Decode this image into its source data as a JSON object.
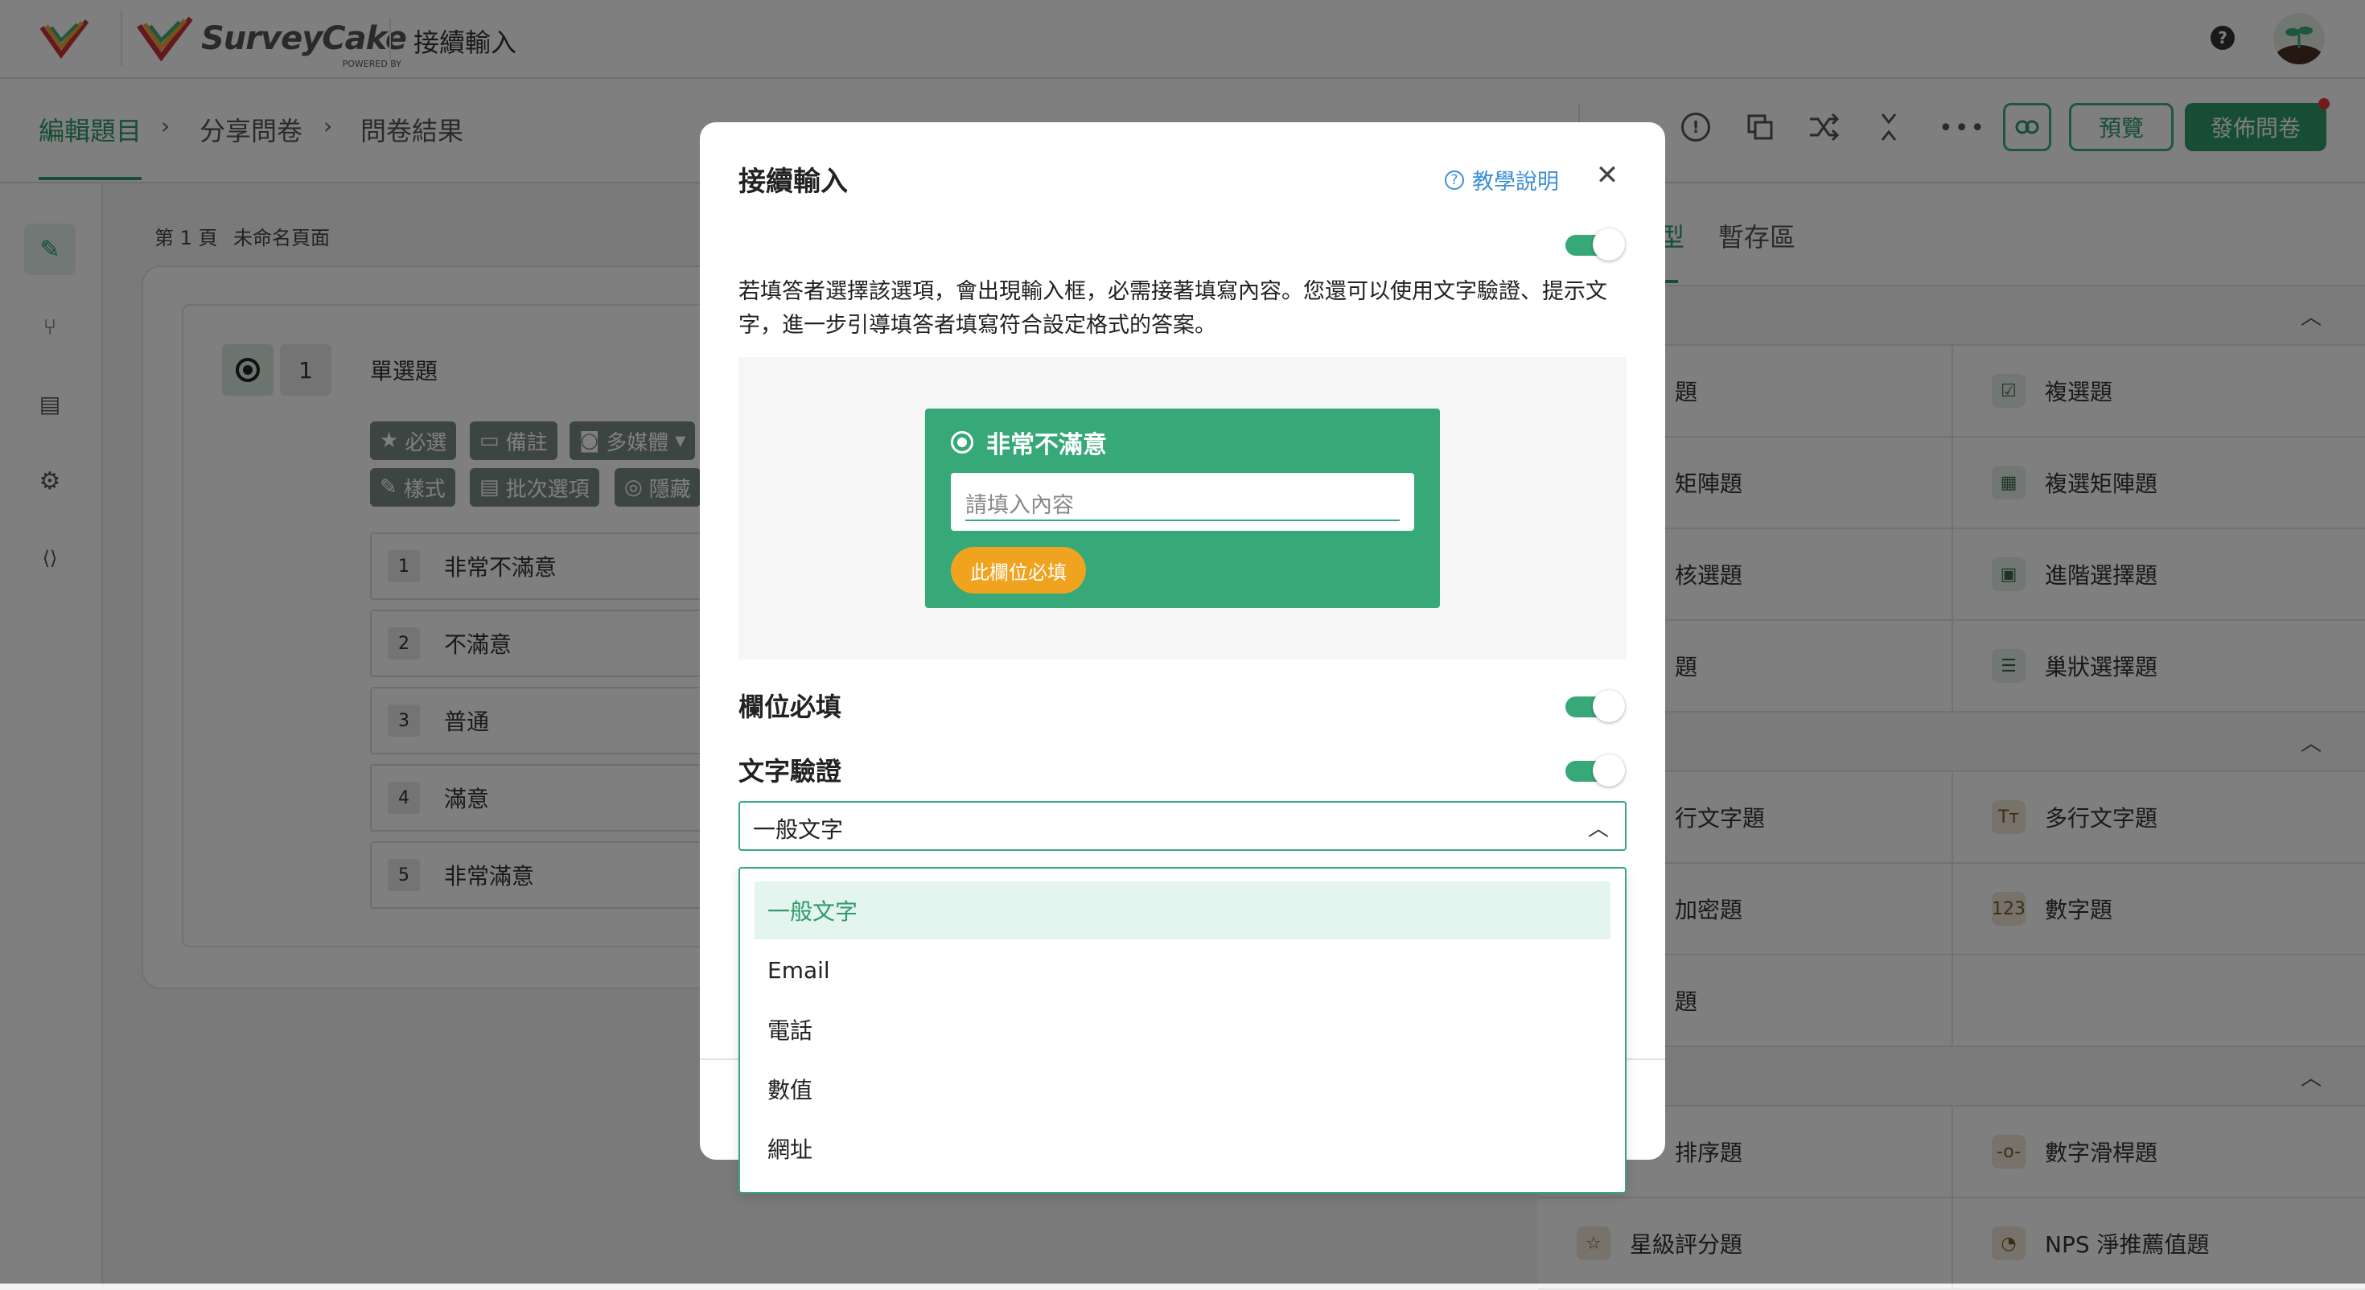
{
  "colors": {
    "accent": "#37a878",
    "accent_dark": "#2e9a6a",
    "orange": "#f0a31f",
    "publish_dot": "#e53935"
  },
  "header": {
    "brand": "SurveyCake",
    "brand_sub": "POWERED BY",
    "page_title": "接續輸入"
  },
  "nav": {
    "tabs": [
      "編輯題目",
      "分享問卷",
      "問卷結果"
    ],
    "preview_label": "預覽",
    "publish_label": "發佈問卷"
  },
  "editor": {
    "page_label": "第 1 頁",
    "page_name": "未命名頁面",
    "question_number": "1",
    "question_type": "單選題",
    "chips": [
      "必選",
      "備註",
      "多媒體",
      "樣式",
      "批次選項",
      "隱藏"
    ],
    "options": [
      {
        "num": "1",
        "label": "非常不滿意"
      },
      {
        "num": "2",
        "label": "不滿意"
      },
      {
        "num": "3",
        "label": "普通"
      },
      {
        "num": "4",
        "label": "滿意"
      },
      {
        "num": "5",
        "label": "非常滿意"
      }
    ]
  },
  "right_panel": {
    "tab_partial": "型",
    "tab_storage": "暫存區",
    "left_col": [
      "題",
      "矩陣題",
      "核選題",
      "題",
      "行文字題",
      "加密題",
      "題",
      "排序題",
      "星級評分題"
    ],
    "right_col": [
      "複選題",
      "複選矩陣題",
      "進階選擇題",
      "巢狀選擇題",
      "多行文字題",
      "數字題",
      "",
      "數字滑桿題",
      "NPS 淨推薦值題"
    ]
  },
  "modal": {
    "title": "接續輸入",
    "help_label": "教學說明",
    "description": "若填答者選擇該選項，會出現輸入框，必需接著填寫內容。您還可以使用文字驗證、提示文字，進一步引導填答者填寫符合設定格式的答案。",
    "preview": {
      "option_label": "非常不滿意",
      "input_placeholder": "請填入內容",
      "required_badge": "此欄位必填"
    },
    "required_label": "欄位必填",
    "validation_label": "文字驗證",
    "select_value": "一般文字",
    "dropdown_options": [
      "一般文字",
      "Email",
      "電話",
      "數值",
      "網址"
    ]
  }
}
